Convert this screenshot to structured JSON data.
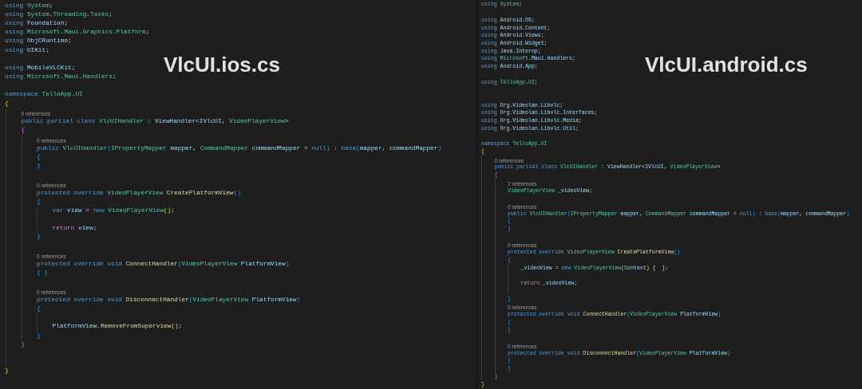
{
  "editors": [
    {
      "title": "VlcUI.ios.cs",
      "lines": [
        {
          "kind": "code",
          "tokens": [
            {
              "t": "using ",
              "kind": "kw"
            },
            {
              "t": "System",
              "kind": "type"
            },
            {
              "t": ";",
              "kind": "p"
            }
          ]
        },
        {
          "kind": "code",
          "tokens": [
            {
              "t": "using ",
              "kind": "kw"
            },
            {
              "t": "System",
              "kind": "type"
            },
            {
              "t": ".",
              "kind": "p"
            },
            {
              "t": "Threading",
              "kind": "type"
            },
            {
              "t": ".",
              "kind": "p"
            },
            {
              "t": "Tasks",
              "kind": "type"
            },
            {
              "t": ";",
              "kind": "p"
            }
          ]
        },
        {
          "kind": "code",
          "tokens": [
            {
              "t": "using ",
              "kind": "kw"
            },
            {
              "t": "Foundation",
              "kind": "id"
            },
            {
              "t": ";",
              "kind": "p"
            }
          ]
        },
        {
          "kind": "code",
          "tokens": [
            {
              "t": "using ",
              "kind": "kw"
            },
            {
              "t": "Microsoft",
              "kind": "type"
            },
            {
              "t": ".",
              "kind": "p"
            },
            {
              "t": "Maui",
              "kind": "type"
            },
            {
              "t": ".",
              "kind": "p"
            },
            {
              "t": "Graphics",
              "kind": "type"
            },
            {
              "t": ".",
              "kind": "p"
            },
            {
              "t": "Platform",
              "kind": "type"
            },
            {
              "t": ";",
              "kind": "p"
            }
          ]
        },
        {
          "kind": "code",
          "tokens": [
            {
              "t": "using ",
              "kind": "kw"
            },
            {
              "t": "ObjCRuntime",
              "kind": "id"
            },
            {
              "t": ";",
              "kind": "p"
            }
          ]
        },
        {
          "kind": "code",
          "tokens": [
            {
              "t": "using ",
              "kind": "kw"
            },
            {
              "t": "UIKit",
              "kind": "id"
            },
            {
              "t": ";",
              "kind": "p"
            }
          ]
        },
        {
          "kind": "blank"
        },
        {
          "kind": "code",
          "tokens": [
            {
              "t": "using ",
              "kind": "kw"
            },
            {
              "t": "MobileVLCKit",
              "kind": "id"
            },
            {
              "t": ";",
              "kind": "p"
            }
          ]
        },
        {
          "kind": "code",
          "tokens": [
            {
              "t": "using ",
              "kind": "kw"
            },
            {
              "t": "Microsoft",
              "kind": "type"
            },
            {
              "t": ".",
              "kind": "p"
            },
            {
              "t": "Maui",
              "kind": "type"
            },
            {
              "t": ".",
              "kind": "p"
            },
            {
              "t": "Handlers",
              "kind": "type"
            },
            {
              "t": ";",
              "kind": "p"
            }
          ]
        },
        {
          "kind": "blank"
        },
        {
          "kind": "code",
          "tokens": [
            {
              "t": "namespace ",
              "kind": "kw"
            },
            {
              "t": "TelloApp",
              "kind": "type"
            },
            {
              "t": ".",
              "kind": "p"
            },
            {
              "t": "UI",
              "kind": "type"
            }
          ]
        },
        {
          "kind": "code",
          "tokens": [
            {
              "t": "{",
              "kind": "b1"
            }
          ],
          "children": [
            {
              "kind": "refs",
              "text": "0 references"
            },
            {
              "kind": "code",
              "tokens": [
                {
                  "t": "public partial class ",
                  "kind": "kw"
                },
                {
                  "t": "VlcUIHandler",
                  "kind": "type"
                },
                {
                  "t": " : ",
                  "kind": "p"
                },
                {
                  "t": "ViewHandler",
                  "kind": "id"
                },
                {
                  "t": "<",
                  "kind": "p"
                },
                {
                  "t": "IVlcUI",
                  "kind": "id"
                },
                {
                  "t": ", ",
                  "kind": "p"
                },
                {
                  "t": "VideoPlayerView",
                  "kind": "type"
                },
                {
                  "t": ">",
                  "kind": "p"
                }
              ]
            },
            {
              "kind": "code",
              "tokens": [
                {
                  "t": "{",
                  "kind": "b2"
                }
              ],
              "children": [
                {
                  "kind": "refs",
                  "text": "0 references"
                },
                {
                  "kind": "code",
                  "tokens": [
                    {
                      "t": "public ",
                      "kind": "kw"
                    },
                    {
                      "t": "VlcUIHandler",
                      "kind": "type"
                    },
                    {
                      "t": "(",
                      "kind": "b3"
                    },
                    {
                      "t": "IPropertyMapper",
                      "kind": "type"
                    },
                    {
                      "t": " mapper",
                      "kind": "id"
                    },
                    {
                      "t": ", ",
                      "kind": "p"
                    },
                    {
                      "t": "CommandMapper",
                      "kind": "type"
                    },
                    {
                      "t": " commandMapper",
                      "kind": "id"
                    },
                    {
                      "t": " = ",
                      "kind": "p"
                    },
                    {
                      "t": "null",
                      "kind": "kw"
                    },
                    {
                      "t": ")",
                      "kind": "b3"
                    },
                    {
                      "t": " : ",
                      "kind": "p"
                    },
                    {
                      "t": "base",
                      "kind": "kw"
                    },
                    {
                      "t": "(",
                      "kind": "b3"
                    },
                    {
                      "t": "mapper",
                      "kind": "id"
                    },
                    {
                      "t": ", ",
                      "kind": "p"
                    },
                    {
                      "t": "commandMapper",
                      "kind": "id"
                    },
                    {
                      "t": ")",
                      "kind": "b3"
                    }
                  ]
                },
                {
                  "kind": "code",
                  "tokens": [
                    {
                      "t": "{",
                      "kind": "b3"
                    }
                  ]
                },
                {
                  "kind": "code",
                  "tokens": [
                    {
                      "t": "}",
                      "kind": "b3"
                    }
                  ]
                },
                {
                  "kind": "blank"
                },
                {
                  "kind": "refs",
                  "text": "0 references"
                },
                {
                  "kind": "code",
                  "tokens": [
                    {
                      "t": "protected override ",
                      "kind": "kw"
                    },
                    {
                      "t": "VideoPlayerView ",
                      "kind": "type"
                    },
                    {
                      "t": "CreatePlatformView",
                      "kind": "fn"
                    },
                    {
                      "t": "()",
                      "kind": "b3"
                    }
                  ]
                },
                {
                  "kind": "code",
                  "tokens": [
                    {
                      "t": "{",
                      "kind": "b3"
                    }
                  ],
                  "children": [
                    {
                      "kind": "code",
                      "tokens": [
                        {
                          "t": "var ",
                          "kind": "kw"
                        },
                        {
                          "t": "view",
                          "kind": "id"
                        },
                        {
                          "t": " = ",
                          "kind": "p"
                        },
                        {
                          "t": "new ",
                          "kind": "kw"
                        },
                        {
                          "t": "VideoPlayerView",
                          "kind": "type"
                        },
                        {
                          "t": "()",
                          "kind": "b1"
                        },
                        {
                          "t": ";",
                          "kind": "p"
                        }
                      ]
                    },
                    {
                      "kind": "blank"
                    },
                    {
                      "kind": "code",
                      "tokens": [
                        {
                          "t": "return ",
                          "kind": "ctrl"
                        },
                        {
                          "t": "view",
                          "kind": "id"
                        },
                        {
                          "t": ";",
                          "kind": "p"
                        }
                      ]
                    }
                  ]
                },
                {
                  "kind": "code",
                  "tokens": [
                    {
                      "t": "}",
                      "kind": "b3"
                    }
                  ]
                },
                {
                  "kind": "blank"
                },
                {
                  "kind": "refs",
                  "text": "0 references"
                },
                {
                  "kind": "code",
                  "tokens": [
                    {
                      "t": "protected override void ",
                      "kind": "kw"
                    },
                    {
                      "t": "ConnectHandler",
                      "kind": "fn"
                    },
                    {
                      "t": "(",
                      "kind": "b3"
                    },
                    {
                      "t": "VideoPlayerView ",
                      "kind": "type"
                    },
                    {
                      "t": "PlatformView",
                      "kind": "id"
                    },
                    {
                      "t": ")",
                      "kind": "b3"
                    }
                  ]
                },
                {
                  "kind": "code",
                  "tokens": [
                    {
                      "t": "{ }",
                      "kind": "b3"
                    }
                  ]
                },
                {
                  "kind": "blank"
                },
                {
                  "kind": "refs",
                  "text": "0 references"
                },
                {
                  "kind": "code",
                  "tokens": [
                    {
                      "t": "protected override void ",
                      "kind": "kw"
                    },
                    {
                      "t": "DisconnectHandler",
                      "kind": "fn"
                    },
                    {
                      "t": "(",
                      "kind": "b3"
                    },
                    {
                      "t": "VideoPlayerView ",
                      "kind": "type"
                    },
                    {
                      "t": "PlatformView",
                      "kind": "id"
                    },
                    {
                      "t": ")",
                      "kind": "b3"
                    }
                  ]
                },
                {
                  "kind": "code",
                  "tokens": [
                    {
                      "t": "{",
                      "kind": "b3"
                    }
                  ],
                  "children": [
                    {
                      "kind": "blank"
                    },
                    {
                      "kind": "code",
                      "tokens": [
                        {
                          "t": "PlatformView",
                          "kind": "id"
                        },
                        {
                          "t": ".",
                          "kind": "p"
                        },
                        {
                          "t": "RemoveFromSuperview",
                          "kind": "fn"
                        },
                        {
                          "t": "()",
                          "kind": "b1"
                        },
                        {
                          "t": ";",
                          "kind": "p"
                        }
                      ]
                    }
                  ]
                },
                {
                  "kind": "code",
                  "tokens": [
                    {
                      "t": "}",
                      "kind": "b3"
                    }
                  ]
                }
              ]
            },
            {
              "kind": "code",
              "tokens": [
                {
                  "t": "}",
                  "kind": "b2"
                }
              ]
            },
            {
              "kind": "blank"
            },
            {
              "kind": "blank"
            }
          ]
        },
        {
          "kind": "code",
          "tokens": [
            {
              "t": "}",
              "kind": "b1"
            }
          ]
        }
      ]
    },
    {
      "title": "VlcUI.android.cs",
      "lines": [
        {
          "kind": "code",
          "tokens": [
            {
              "t": "using ",
              "kind": "kw"
            },
            {
              "t": "System",
              "kind": "type"
            },
            {
              "t": ";",
              "kind": "p"
            }
          ]
        },
        {
          "kind": "blank"
        },
        {
          "kind": "code",
          "tokens": [
            {
              "t": "using ",
              "kind": "kw"
            },
            {
              "t": "Android",
              "kind": "id"
            },
            {
              "t": ".",
              "kind": "p"
            },
            {
              "t": "OS",
              "kind": "id"
            },
            {
              "t": ";",
              "kind": "p"
            }
          ]
        },
        {
          "kind": "code",
          "tokens": [
            {
              "t": "using ",
              "kind": "kw"
            },
            {
              "t": "Android",
              "kind": "id"
            },
            {
              "t": ".",
              "kind": "p"
            },
            {
              "t": "Content",
              "kind": "id"
            },
            {
              "t": ";",
              "kind": "p"
            }
          ]
        },
        {
          "kind": "code",
          "tokens": [
            {
              "t": "using ",
              "kind": "kw"
            },
            {
              "t": "Android",
              "kind": "id"
            },
            {
              "t": ".",
              "kind": "p"
            },
            {
              "t": "Views",
              "kind": "id"
            },
            {
              "t": ";",
              "kind": "p"
            }
          ]
        },
        {
          "kind": "code",
          "tokens": [
            {
              "t": "using ",
              "kind": "kw"
            },
            {
              "t": "Android",
              "kind": "id"
            },
            {
              "t": ".",
              "kind": "p"
            },
            {
              "t": "Widget",
              "kind": "id"
            },
            {
              "t": ";",
              "kind": "p"
            }
          ]
        },
        {
          "kind": "code",
          "tokens": [
            {
              "t": "using ",
              "kind": "kw"
            },
            {
              "t": "Java",
              "kind": "id"
            },
            {
              "t": ".",
              "kind": "p"
            },
            {
              "t": "Interop",
              "kind": "id"
            },
            {
              "t": ";",
              "kind": "p"
            }
          ]
        },
        {
          "kind": "code",
          "tokens": [
            {
              "t": "using ",
              "kind": "kw"
            },
            {
              "t": "Microsoft",
              "kind": "type"
            },
            {
              "t": ".",
              "kind": "p"
            },
            {
              "t": "Maui",
              "kind": "id"
            },
            {
              "t": ".",
              "kind": "p"
            },
            {
              "t": "Handlers",
              "kind": "id"
            },
            {
              "t": ";",
              "kind": "p"
            }
          ]
        },
        {
          "kind": "code",
          "tokens": [
            {
              "t": "using ",
              "kind": "kw"
            },
            {
              "t": "Android",
              "kind": "id"
            },
            {
              "t": ".",
              "kind": "p"
            },
            {
              "t": "App",
              "kind": "id"
            },
            {
              "t": ";",
              "kind": "p"
            }
          ]
        },
        {
          "kind": "blank"
        },
        {
          "kind": "code",
          "tokens": [
            {
              "t": "using ",
              "kind": "kw"
            },
            {
              "t": "TelloApp",
              "kind": "type"
            },
            {
              "t": ".",
              "kind": "p"
            },
            {
              "t": "UI",
              "kind": "type"
            },
            {
              "t": ";",
              "kind": "p"
            }
          ]
        },
        {
          "kind": "blank"
        },
        {
          "kind": "blank"
        },
        {
          "kind": "code",
          "tokens": [
            {
              "t": "using ",
              "kind": "kw"
            },
            {
              "t": "Org",
              "kind": "id"
            },
            {
              "t": ".",
              "kind": "p"
            },
            {
              "t": "Videolan",
              "kind": "id"
            },
            {
              "t": ".",
              "kind": "p"
            },
            {
              "t": "Libvlc",
              "kind": "id"
            },
            {
              "t": ";",
              "kind": "p"
            }
          ]
        },
        {
          "kind": "code",
          "tokens": [
            {
              "t": "using ",
              "kind": "kw"
            },
            {
              "t": "Org",
              "kind": "id"
            },
            {
              "t": ".",
              "kind": "p"
            },
            {
              "t": "Videolan",
              "kind": "id"
            },
            {
              "t": ".",
              "kind": "p"
            },
            {
              "t": "Libvlc",
              "kind": "id"
            },
            {
              "t": ".",
              "kind": "p"
            },
            {
              "t": "Interfaces",
              "kind": "id"
            },
            {
              "t": ";",
              "kind": "p"
            }
          ]
        },
        {
          "kind": "code",
          "tokens": [
            {
              "t": "using ",
              "kind": "kw"
            },
            {
              "t": "Org",
              "kind": "id"
            },
            {
              "t": ".",
              "kind": "p"
            },
            {
              "t": "Videolan",
              "kind": "id"
            },
            {
              "t": ".",
              "kind": "p"
            },
            {
              "t": "Libvlc",
              "kind": "id"
            },
            {
              "t": ".",
              "kind": "p"
            },
            {
              "t": "Media",
              "kind": "id"
            },
            {
              "t": ";",
              "kind": "p"
            }
          ]
        },
        {
          "kind": "code",
          "tokens": [
            {
              "t": "using ",
              "kind": "kw"
            },
            {
              "t": "Org",
              "kind": "id"
            },
            {
              "t": ".",
              "kind": "p"
            },
            {
              "t": "Videolan",
              "kind": "id"
            },
            {
              "t": ".",
              "kind": "p"
            },
            {
              "t": "Libvlc",
              "kind": "id"
            },
            {
              "t": ".",
              "kind": "p"
            },
            {
              "t": "Util",
              "kind": "id"
            },
            {
              "t": ";",
              "kind": "p"
            }
          ]
        },
        {
          "kind": "blank"
        },
        {
          "kind": "code",
          "tokens": [
            {
              "t": "namespace ",
              "kind": "kw"
            },
            {
              "t": "TelloApp",
              "kind": "type"
            },
            {
              "t": ".",
              "kind": "p"
            },
            {
              "t": "UI",
              "kind": "type"
            }
          ]
        },
        {
          "kind": "code",
          "tokens": [
            {
              "t": "{",
              "kind": "b1"
            }
          ],
          "children": [
            {
              "kind": "refs",
              "text": "0 references"
            },
            {
              "kind": "code",
              "tokens": [
                {
                  "t": "public partial class ",
                  "kind": "kw"
                },
                {
                  "t": "VlcUIHandler",
                  "kind": "type"
                },
                {
                  "t": " : ",
                  "kind": "p"
                },
                {
                  "t": "ViewHandler",
                  "kind": "id"
                },
                {
                  "t": "<",
                  "kind": "p"
                },
                {
                  "t": "IVlcUI",
                  "kind": "id"
                },
                {
                  "t": ", ",
                  "kind": "p"
                },
                {
                  "t": "VideoPlayerView",
                  "kind": "type"
                },
                {
                  "t": ">",
                  "kind": "p"
                }
              ]
            },
            {
              "kind": "code",
              "tokens": [
                {
                  "t": "{",
                  "kind": "b2"
                }
              ],
              "children": [
                {
                  "kind": "refs",
                  "text": "2 references"
                },
                {
                  "kind": "code",
                  "tokens": [
                    {
                      "t": "VideoPlayerView ",
                      "kind": "type"
                    },
                    {
                      "t": "_videoView",
                      "kind": "id"
                    },
                    {
                      "t": ";",
                      "kind": "p"
                    }
                  ]
                },
                {
                  "kind": "blank"
                },
                {
                  "kind": "refs",
                  "text": "0 references"
                },
                {
                  "kind": "code",
                  "tokens": [
                    {
                      "t": "public ",
                      "kind": "kw"
                    },
                    {
                      "t": "VlcUIHandler",
                      "kind": "type"
                    },
                    {
                      "t": "(",
                      "kind": "b3"
                    },
                    {
                      "t": "IPropertyMapper",
                      "kind": "type"
                    },
                    {
                      "t": " mapper",
                      "kind": "id"
                    },
                    {
                      "t": ", ",
                      "kind": "p"
                    },
                    {
                      "t": "CommandMapper",
                      "kind": "type"
                    },
                    {
                      "t": " commandMapper",
                      "kind": "id"
                    },
                    {
                      "t": " = ",
                      "kind": "p"
                    },
                    {
                      "t": "null",
                      "kind": "kw"
                    },
                    {
                      "t": ")",
                      "kind": "b3"
                    },
                    {
                      "t": " : ",
                      "kind": "p"
                    },
                    {
                      "t": "base",
                      "kind": "kw"
                    },
                    {
                      "t": "(",
                      "kind": "b3"
                    },
                    {
                      "t": "mapper",
                      "kind": "id"
                    },
                    {
                      "t": ", ",
                      "kind": "p"
                    },
                    {
                      "t": "commandMapper",
                      "kind": "id"
                    },
                    {
                      "t": ")",
                      "kind": "b3"
                    }
                  ]
                },
                {
                  "kind": "code",
                  "tokens": [
                    {
                      "t": "{",
                      "kind": "b3"
                    }
                  ]
                },
                {
                  "kind": "code",
                  "tokens": [
                    {
                      "t": "}",
                      "kind": "b3"
                    }
                  ]
                },
                {
                  "kind": "blank"
                },
                {
                  "kind": "refs",
                  "text": "0 references"
                },
                {
                  "kind": "code",
                  "tokens": [
                    {
                      "t": "protected override ",
                      "kind": "kw"
                    },
                    {
                      "t": "VideoPlayerView ",
                      "kind": "type"
                    },
                    {
                      "t": "CreatePlatformView",
                      "kind": "fn"
                    },
                    {
                      "t": "()",
                      "kind": "b3"
                    }
                  ]
                },
                {
                  "kind": "code",
                  "tokens": [
                    {
                      "t": "{",
                      "kind": "b3"
                    }
                  ],
                  "children": [
                    {
                      "kind": "code",
                      "tokens": [
                        {
                          "t": "_videoView",
                          "kind": "id"
                        },
                        {
                          "t": " = ",
                          "kind": "p"
                        },
                        {
                          "t": "new ",
                          "kind": "kw"
                        },
                        {
                          "t": "VideoPlayerView",
                          "kind": "type"
                        },
                        {
                          "t": "(",
                          "kind": "b1"
                        },
                        {
                          "t": "Context",
                          "kind": "id"
                        },
                        {
                          "t": ")",
                          "kind": "b1"
                        },
                        {
                          "t": " {  };",
                          "kind": "b1"
                        }
                      ]
                    },
                    {
                      "kind": "blank"
                    },
                    {
                      "kind": "code",
                      "tokens": [
                        {
                          "t": "return ",
                          "kind": "ctrl"
                        },
                        {
                          "t": "_videoView",
                          "kind": "id"
                        },
                        {
                          "t": ";",
                          "kind": "p"
                        }
                      ]
                    },
                    {
                      "kind": "blank"
                    }
                  ]
                },
                {
                  "kind": "code",
                  "tokens": [
                    {
                      "t": "}",
                      "kind": "b3"
                    }
                  ]
                },
                {
                  "kind": "refs",
                  "text": "0 references"
                },
                {
                  "kind": "code",
                  "tokens": [
                    {
                      "t": "protected override void ",
                      "kind": "kw"
                    },
                    {
                      "t": "ConnectHandler",
                      "kind": "fn"
                    },
                    {
                      "t": "(",
                      "kind": "b3"
                    },
                    {
                      "t": "VideoPlayerView ",
                      "kind": "type"
                    },
                    {
                      "t": "PlatformView",
                      "kind": "id"
                    },
                    {
                      "t": ")",
                      "kind": "b3"
                    }
                  ]
                },
                {
                  "kind": "code",
                  "tokens": [
                    {
                      "t": "{",
                      "kind": "b3"
                    }
                  ]
                },
                {
                  "kind": "code",
                  "tokens": [
                    {
                      "t": "}",
                      "kind": "b3"
                    }
                  ]
                },
                {
                  "kind": "blank"
                },
                {
                  "kind": "refs",
                  "text": "0 references"
                },
                {
                  "kind": "code",
                  "tokens": [
                    {
                      "t": "protected override void ",
                      "kind": "kw"
                    },
                    {
                      "t": "DisconnectHandler",
                      "kind": "fn"
                    },
                    {
                      "t": "(",
                      "kind": "b3"
                    },
                    {
                      "t": "VideoPlayerView ",
                      "kind": "type"
                    },
                    {
                      "t": "PlatformView",
                      "kind": "id"
                    },
                    {
                      "t": ")",
                      "kind": "b3"
                    }
                  ]
                },
                {
                  "kind": "code",
                  "tokens": [
                    {
                      "t": "{",
                      "kind": "b3"
                    }
                  ]
                },
                {
                  "kind": "code",
                  "tokens": [
                    {
                      "t": "}",
                      "kind": "b3"
                    }
                  ]
                }
              ]
            },
            {
              "kind": "code",
              "tokens": [
                {
                  "t": "}",
                  "kind": "b2"
                }
              ]
            }
          ]
        },
        {
          "kind": "code",
          "tokens": [
            {
              "t": "}",
              "kind": "b1"
            }
          ]
        }
      ]
    }
  ]
}
